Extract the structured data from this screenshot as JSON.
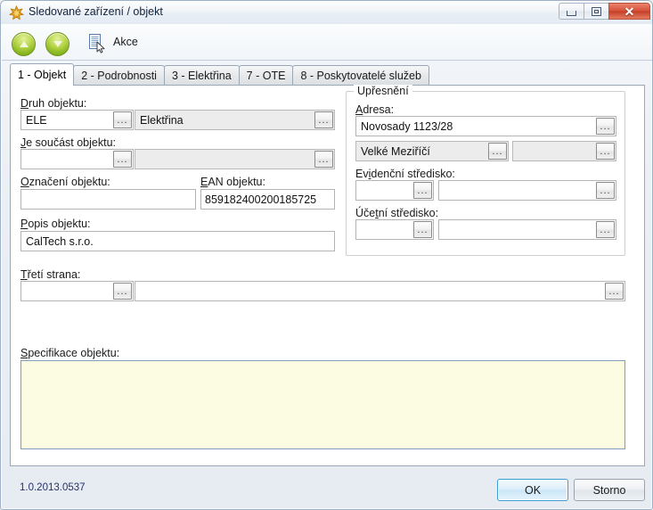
{
  "window": {
    "title": "Sledované zařízení / objekt",
    "app_icon": "starburst-icon",
    "controls": {
      "minimize": "minimize-icon",
      "maximize": "maximize-icon",
      "close": "✕"
    }
  },
  "toolbar": {
    "up_button": "up-arrow-icon",
    "down_button": "down-arrow-icon",
    "actions_icon": "document-cursor-icon",
    "actions_label": "Akce"
  },
  "tabs": [
    {
      "label": "1 - Objekt",
      "active": true
    },
    {
      "label": "2 - Podrobnosti",
      "active": false
    },
    {
      "label": "3 - Elektřina",
      "active": false
    },
    {
      "label": "7 - OTE",
      "active": false
    },
    {
      "label": "8 - Poskytovatelé služeb",
      "active": false
    }
  ],
  "form": {
    "druh_objektu": {
      "label": "Druh objektu:",
      "code_value": "ELE",
      "name_value": "Elektřina",
      "ellipsis": "..."
    },
    "je_soucast_objektu": {
      "label": "Je součást objektu:",
      "code_value": "",
      "name_value": "",
      "ellipsis": "..."
    },
    "oznaceni_objektu": {
      "label": "Označení objektu:",
      "value": ""
    },
    "ean_objektu": {
      "label": "EAN objektu:",
      "value": "859182400200185725"
    },
    "popis_objektu": {
      "label": "Popis objektu:",
      "value": "CalTech s.r.o."
    },
    "treti_strana": {
      "label": "Třetí strana:",
      "code_value": "",
      "name_value": "",
      "ellipsis": "..."
    },
    "specifikace_objektu": {
      "label": "Specifikace objektu:",
      "value": ""
    }
  },
  "upresneni": {
    "title": "Upřesnění",
    "adresa": {
      "label": "Adresa:",
      "street_value": "Novosady 1123/28",
      "city_value": "Velké Meziříčí",
      "extra_value": "",
      "ellipsis": "..."
    },
    "evidencni_stredisko": {
      "label": "Evidenční středisko:",
      "code_value": "",
      "name_value": "",
      "ellipsis": "..."
    },
    "ucetni_stredisko": {
      "label": "Účetní středisko:",
      "code_value": "",
      "name_value": "",
      "ellipsis": "..."
    }
  },
  "footer": {
    "version": "1.0.2013.0537",
    "ok_label": "OK",
    "cancel_label": "Storno"
  },
  "colors": {
    "accent_blue": "#3c9cd4",
    "close_red": "#c33f28",
    "toolbar_green": "#8ab822",
    "spec_background": "#fcfce3",
    "version_text": "#24306b"
  }
}
